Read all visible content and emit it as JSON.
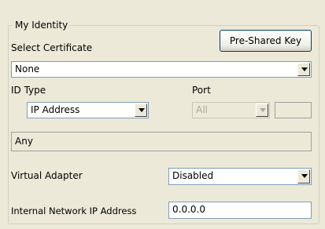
{
  "identity": {
    "group_title": "My Identity",
    "select_certificate_label": "Select Certificate",
    "pre_shared_key_button": "Pre-Shared Key",
    "certificate_value": "None",
    "id_type_label": "ID Type",
    "id_type_value": "IP Address",
    "port_label": "Port",
    "port_value": "All",
    "port_number_value": "",
    "id_value": "Any",
    "virtual_adapter_label": "Virtual Adapter",
    "virtual_adapter_value": "Disabled",
    "internal_ip_label": "Internal Network IP Address",
    "internal_ip_value": "0.0.0.0"
  }
}
